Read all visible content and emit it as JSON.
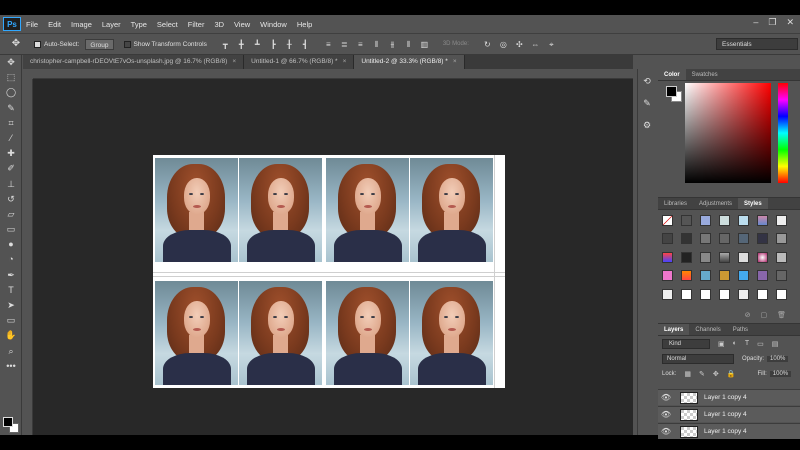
{
  "menubar": {
    "logo": "Ps",
    "items": [
      "File",
      "Edit",
      "Image",
      "Layer",
      "Type",
      "Select",
      "Filter",
      "3D",
      "View",
      "Window",
      "Help"
    ],
    "window_controls": [
      "–",
      "❐",
      "✕"
    ]
  },
  "options": {
    "auto_select_label": "Auto-Select:",
    "auto_select_value": "Group",
    "show_transform_label": "Show Transform Controls",
    "mode_3d_label": "3D Mode:",
    "workspace": "Essentials"
  },
  "tabs": [
    {
      "label": "christopher-campbell-rDEOVtE7vOs-unsplash.jpg @ 16.7% (RGB/8)",
      "active": false
    },
    {
      "label": "Untitled-1 @ 66.7% (RGB/8) *",
      "active": false
    },
    {
      "label": "Untitled-2 @ 33.3% (RGB/8) *",
      "active": true
    }
  ],
  "panels": {
    "color_tabs": [
      "Color",
      "Swatches"
    ],
    "style_tabs": [
      "Libraries",
      "Adjustments",
      "Styles"
    ],
    "layer_tabs": [
      "Layers",
      "Channels",
      "Paths"
    ],
    "kind_filter": "Kind",
    "blend_mode": "Normal",
    "opacity_label": "Opacity:",
    "opacity_value": "100%",
    "lock_label": "Lock:",
    "fill_label": "Fill:",
    "fill_value": "100%",
    "layers": [
      {
        "name": "Layer 1 copy 4"
      },
      {
        "name": "Layer 1 copy 4"
      },
      {
        "name": "Layer 1 copy 4"
      }
    ]
  },
  "colors": {
    "accent": "#31a8ff",
    "foreground": "#000000",
    "background": "#ffffff"
  }
}
